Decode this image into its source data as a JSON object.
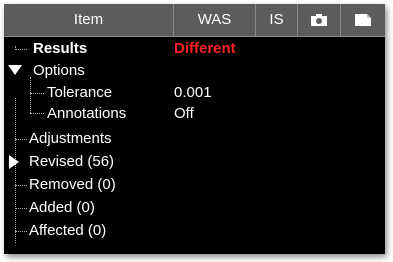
{
  "header": {
    "item_label": "Item",
    "was_label": "WAS",
    "is_label": "IS",
    "camera_icon": "camera-icon",
    "document_icon": "document-icon"
  },
  "tree": {
    "results": {
      "label": "Results",
      "value": "Different",
      "value_color": "#ff2020"
    },
    "options": {
      "label": "Options",
      "expanded": true
    },
    "tolerance": {
      "label": "Tolerance",
      "value": "0.001"
    },
    "annotations": {
      "label": "Annotations",
      "value": "Off"
    },
    "adjustments": {
      "label": "Adjustments"
    },
    "revised": {
      "label": "Revised (56)",
      "expanded": false
    },
    "removed": {
      "label": "Removed (0)"
    },
    "added": {
      "label": "Added (0)"
    },
    "affected": {
      "label": "Affected (0)"
    }
  }
}
